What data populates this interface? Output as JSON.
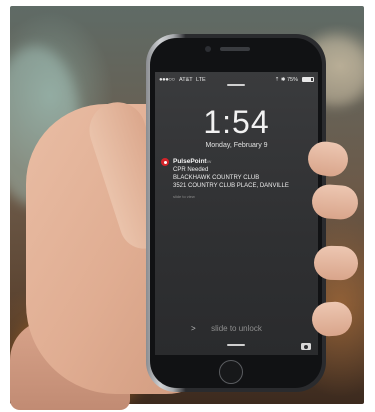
{
  "status_bar": {
    "signal": "●●●○○",
    "carrier": "AT&T",
    "network": "LTE",
    "right": "⇡ ✱ 75%",
    "battery_level": 0.75
  },
  "lock_screen": {
    "time": "1:54",
    "date": "Monday, February 9"
  },
  "notification": {
    "app_name": "PulsePoint",
    "time": "now",
    "lines": [
      "CPR Needed",
      "BLACKHAWK COUNTRY CLUB",
      "3521 COUNTRY CLUB PLACE, DANVILLE"
    ],
    "hint": "slide to view",
    "icon_color": "#d4242a"
  },
  "bottom": {
    "chevron": ">",
    "slide_text": "slide to unlock",
    "camera_icon": "camera-icon"
  }
}
